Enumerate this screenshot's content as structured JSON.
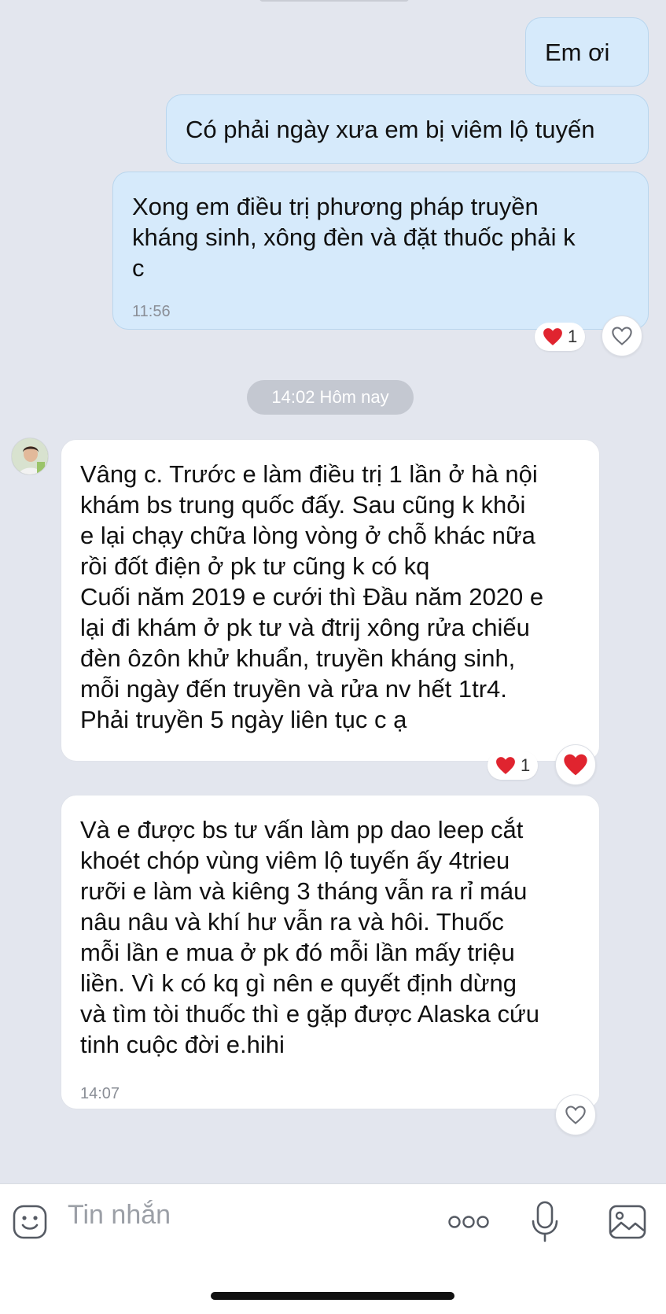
{
  "chat": {
    "messages": [
      {
        "text": "Em ơi"
      },
      {
        "text": "Có phải ngày xưa em bị viêm lộ tuyến"
      },
      {
        "text": "Xong em điều trị phương pháp truyền\nkháng sinh, xông đèn và đặt thuốc phải k\nc",
        "time": "11:56",
        "reaction_count": "1"
      },
      {
        "text": "Vâng c. Trước e làm điều trị 1 lần ở hà nội\nkhám bs trung quốc đấy. Sau cũng k khỏi\ne lại chạy chữa lòng vòng ở chỗ khác nữa\nrồi đốt điện ở pk tư cũng k có kq\nCuối năm 2019 e cưới thì Đầu năm 2020 e\nlại đi khám ở pk tư và đtrij xông rửa chiếu\nđèn ôzôn khử khuẩn, truyền kháng sinh,\nmỗi ngày đến truyền và rửa nv hết 1tr4.\nPhải truyền 5 ngày liên tục c ạ",
        "reaction_count": "1"
      },
      {
        "text": "Và e được bs tư vấn làm pp dao leep cắt\nkhoét chóp vùng viêm lộ tuyến ấy 4trieu\nrưỡi e làm và kiêng 3 tháng vẫn ra rỉ máu\nnâu nâu và khí hư vẫn ra và hôi. Thuốc\nmỗi lần e mua ở pk đó mỗi lần mấy triệu\nliền. Vì k có kq gì nên e quyết định dừng\nvà tìm tòi thuốc thì e gặp được Alaska cứu\ntinh cuộc đời e.hihi",
        "time": "14:07"
      }
    ],
    "date_divider": "14:02 Hôm nay"
  },
  "composer": {
    "placeholder": "Tin nhắn",
    "icons": [
      "sticker-icon",
      "more-dots-icon",
      "microphone-icon",
      "image-icon"
    ]
  },
  "colors": {
    "outgoing_bubble": "#d6eafb",
    "incoming_bubble": "#ffffff",
    "background": "#e3e6ee",
    "heart": "#e0242f"
  }
}
